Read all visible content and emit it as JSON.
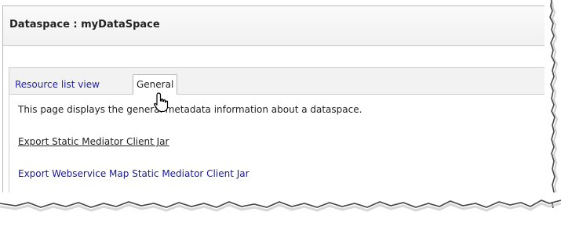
{
  "header": {
    "title": "Dataspace : myDataSpace"
  },
  "tabs": [
    {
      "label": "Resource list view",
      "active": false
    },
    {
      "label": "General",
      "active": true
    }
  ],
  "content": {
    "description": "This page displays the general metadata information about a dataspace.",
    "links": [
      {
        "label": "Export Static Mediator Client Jar",
        "state": "hover"
      },
      {
        "label": "Export Webservice Map Static Mediator Client Jar",
        "state": "normal"
      }
    ]
  },
  "colors": {
    "link": "#1a1a99",
    "tab_strip": "#f2f2f2",
    "border": "#cfcfcf"
  },
  "icons": {
    "cursor": "hand-pointer-cursor"
  }
}
